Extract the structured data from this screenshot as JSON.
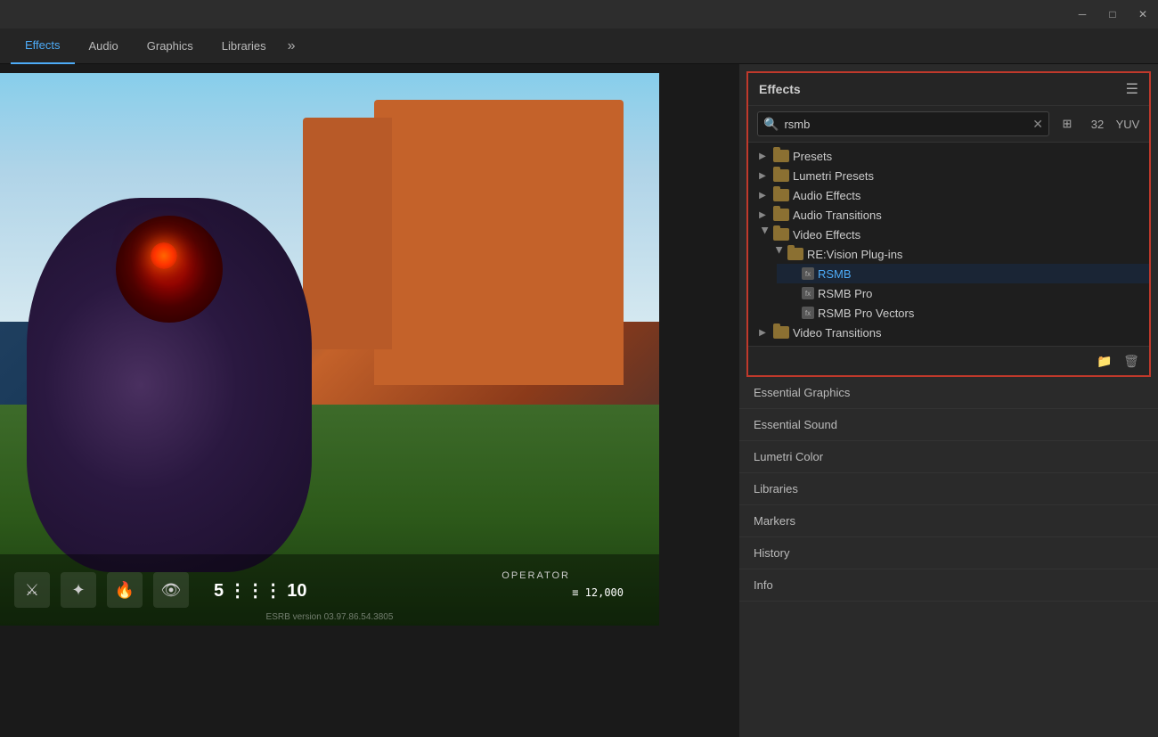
{
  "titleBar": {
    "minimizeIcon": "─",
    "maximizeIcon": "□",
    "closeIcon": "✕"
  },
  "tabs": {
    "items": [
      {
        "label": "Effects",
        "active": true
      },
      {
        "label": "Audio",
        "active": false
      },
      {
        "label": "Graphics",
        "active": false
      },
      {
        "label": "Libraries",
        "active": false
      }
    ],
    "moreIcon": "»"
  },
  "effectsPanel": {
    "title": "Effects",
    "menuIcon": "☰",
    "search": {
      "placeholder": "Search",
      "value": "rsmb"
    },
    "toolbarBtns": [
      "⊞",
      "32",
      "YUV"
    ],
    "tree": [
      {
        "label": "Presets",
        "type": "folder",
        "expanded": false,
        "indent": 0
      },
      {
        "label": "Lumetri Presets",
        "type": "folder",
        "expanded": false,
        "indent": 0
      },
      {
        "label": "Audio Effects",
        "type": "folder",
        "expanded": false,
        "indent": 0
      },
      {
        "label": "Audio Transitions",
        "type": "folder",
        "expanded": false,
        "indent": 0
      },
      {
        "label": "Video Effects",
        "type": "folder",
        "expanded": true,
        "indent": 0
      },
      {
        "label": "RE:Vision Plug-ins",
        "type": "folder",
        "expanded": true,
        "indent": 1
      },
      {
        "label": "RSMB",
        "type": "effect",
        "indent": 2,
        "selected": true
      },
      {
        "label": "RSMB Pro",
        "type": "effect",
        "indent": 2,
        "selected": false
      },
      {
        "label": "RSMB Pro Vectors",
        "type": "effect",
        "indent": 2,
        "selected": false
      },
      {
        "label": "Video Transitions",
        "type": "folder",
        "expanded": false,
        "indent": 0
      }
    ],
    "footer": {
      "folderIcon": "📁",
      "deleteIcon": "🗑"
    }
  },
  "sidePanelItems": [
    {
      "label": "Essential Graphics"
    },
    {
      "label": "Essential Sound"
    },
    {
      "label": "Lumetri Color"
    },
    {
      "label": "Libraries"
    },
    {
      "label": "Markers"
    },
    {
      "label": "History"
    },
    {
      "label": "Info"
    }
  ],
  "hud": {
    "ammo": "≡ 12,000",
    "operatorLabel": "OPERATOR",
    "version": "ESRB version 03.97.86.54.3805"
  }
}
